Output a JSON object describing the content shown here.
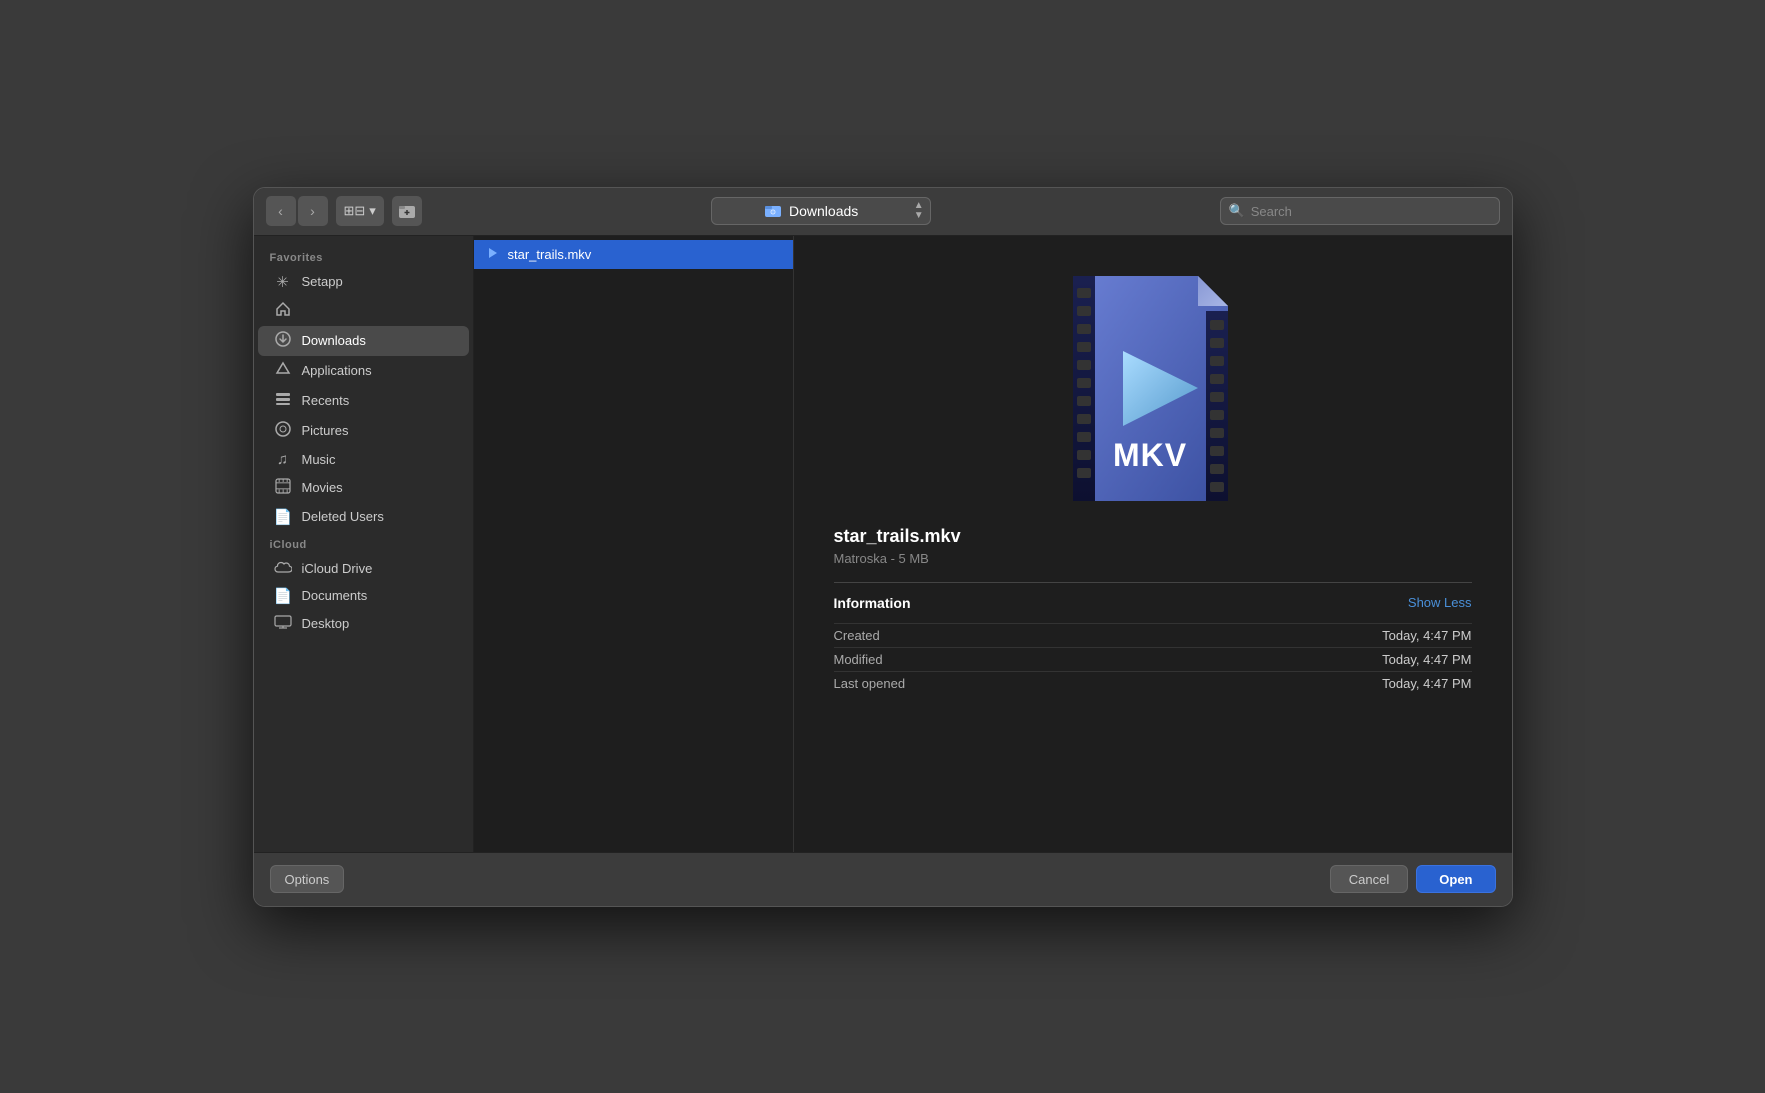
{
  "toolbar": {
    "back_label": "‹",
    "forward_label": "›",
    "view_label": "⊞",
    "view_chevron": "▾",
    "new_folder_label": "⊡",
    "location_icon": "⊕",
    "location_label": "Downloads",
    "search_placeholder": "Search",
    "dropdown_up": "▲",
    "dropdown_down": "▼"
  },
  "sidebar": {
    "favorites_label": "Favorites",
    "icloud_label": "iCloud",
    "items": [
      {
        "id": "setapp",
        "icon": "✳",
        "label": "Setapp"
      },
      {
        "id": "home",
        "icon": "⌂",
        "label": ""
      },
      {
        "id": "downloads",
        "icon": "⊙",
        "label": "Downloads"
      },
      {
        "id": "applications",
        "icon": "✦",
        "label": "Applications"
      },
      {
        "id": "recents",
        "icon": "☰",
        "label": "Recents"
      },
      {
        "id": "pictures",
        "icon": "◎",
        "label": "Pictures"
      },
      {
        "id": "music",
        "icon": "♫",
        "label": "Music"
      },
      {
        "id": "movies",
        "icon": "▦",
        "label": "Movies"
      },
      {
        "id": "deleted-users",
        "icon": "📄",
        "label": "Deleted Users"
      }
    ],
    "icloud_items": [
      {
        "id": "icloud-drive",
        "icon": "☁",
        "label": "iCloud Drive"
      },
      {
        "id": "documents",
        "icon": "📄",
        "label": "Documents"
      },
      {
        "id": "desktop",
        "icon": "▤",
        "label": "Desktop"
      }
    ]
  },
  "file_list": {
    "files": [
      {
        "id": "star_trails",
        "icon": "▶",
        "label": "star_trails.mkv",
        "selected": true
      }
    ]
  },
  "preview": {
    "file_name": "star_trails.mkv",
    "file_meta": "Matroska - 5 MB",
    "info_title": "Information",
    "show_less_label": "Show Less",
    "rows": [
      {
        "label": "Created",
        "value": "Today, 4:47 PM"
      },
      {
        "label": "Modified",
        "value": "Today, 4:47 PM"
      },
      {
        "label": "Last opened",
        "value": "Today, 4:47 PM"
      }
    ]
  },
  "bottom_bar": {
    "options_label": "Options",
    "cancel_label": "Cancel",
    "open_label": "Open"
  }
}
